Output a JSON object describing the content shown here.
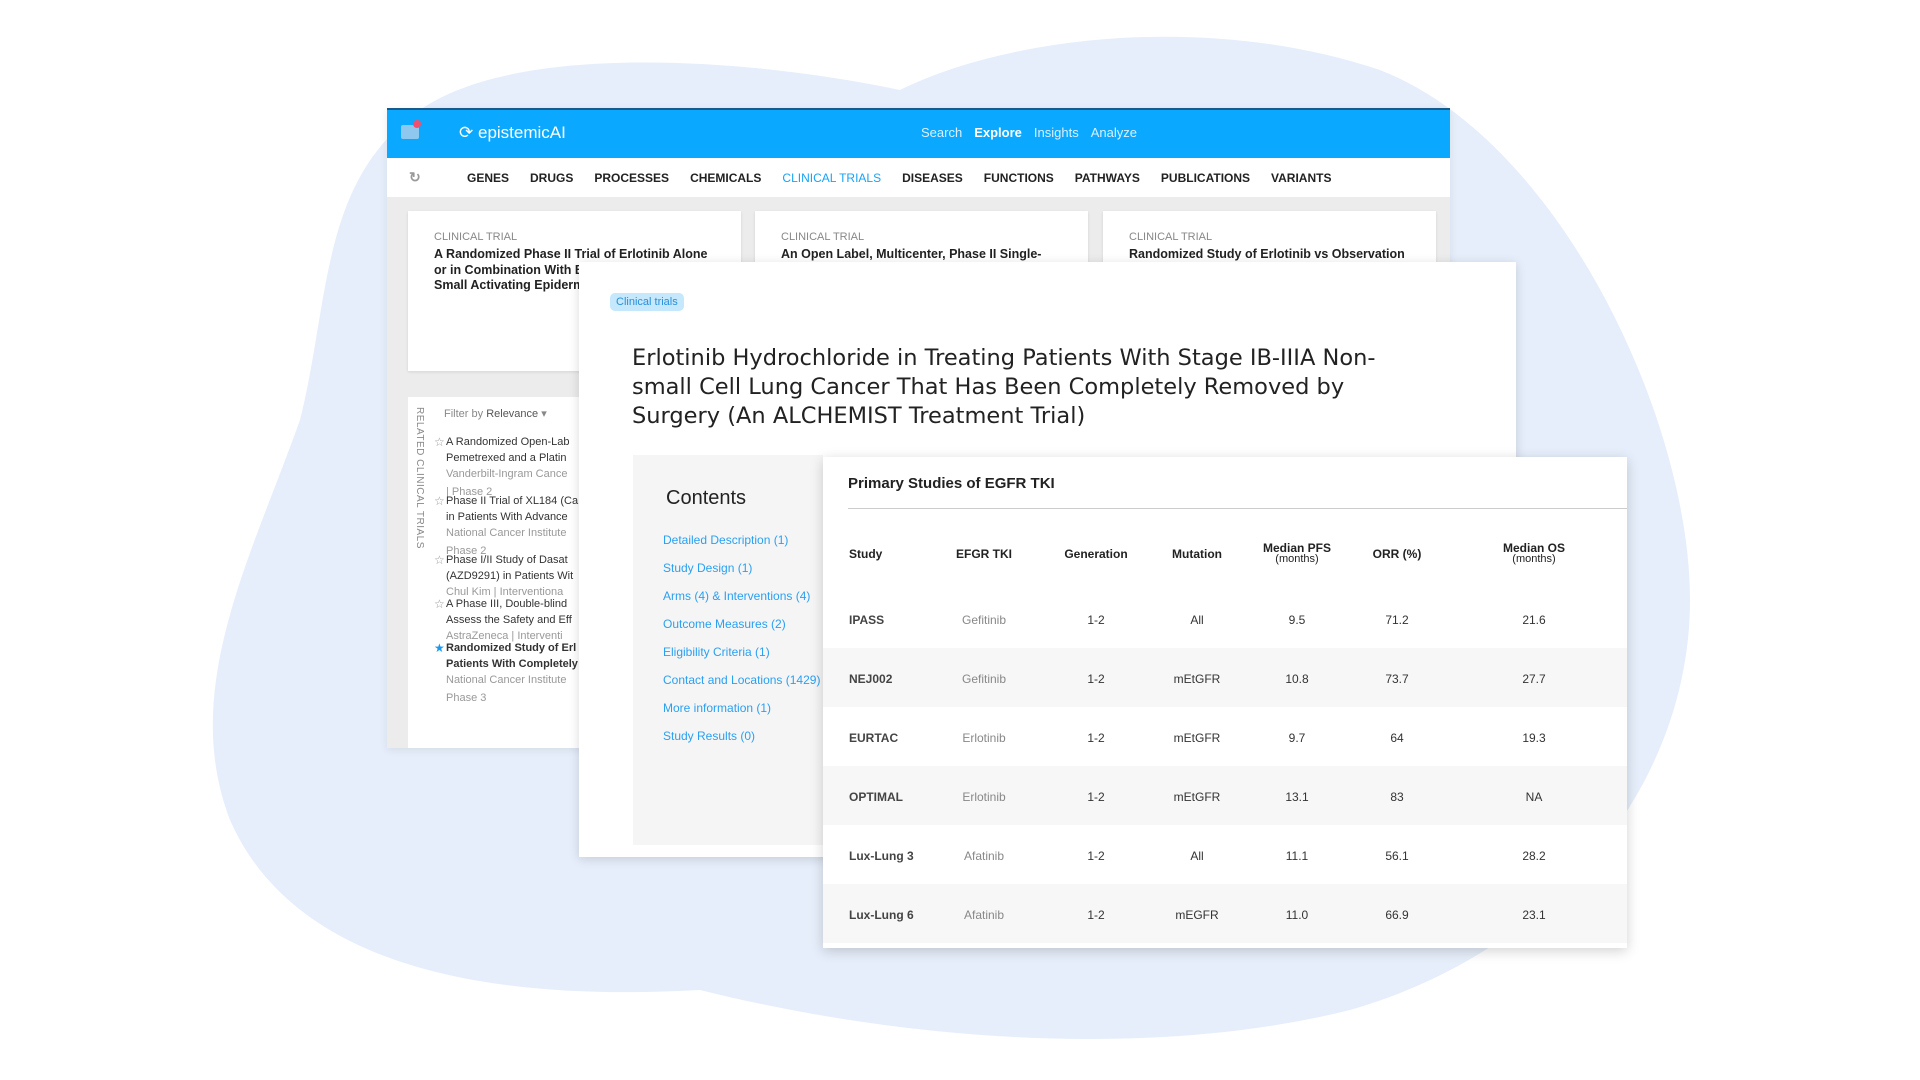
{
  "colors": {
    "header": "#0aa8ff",
    "accent": "#19a3f5",
    "blob": "#e6eefb"
  },
  "header": {
    "logo": "epistemicAI",
    "nav": [
      {
        "label": "Search"
      },
      {
        "label": "Explore",
        "active": true
      },
      {
        "label": "Insights"
      },
      {
        "label": "Analyze"
      }
    ]
  },
  "categories": [
    "GENES",
    "DRUGS",
    "PROCESSES",
    "CHEMICALS",
    "CLINICAL TRIALS",
    "DISEASES",
    "FUNCTIONS",
    "PATHWAYS",
    "PUBLICATIONS",
    "VARIANTS"
  ],
  "active_category": "CLINICAL TRIALS",
  "cards": [
    {
      "kind": "CLINICAL TRIAL",
      "title": "A Randomized Phase II Trial of Erlotinib Alone or in Combination With B Patients With Non-Small Activating Epidermal Gro Mutations"
    },
    {
      "kind": "CLINICAL TRIAL",
      "title": "An Open Label, Multicenter, Phase II Single-Arm"
    },
    {
      "kind": "CLINICAL TRIAL",
      "title": "Randomized Study of Erlotinib vs Observation"
    }
  ],
  "related": {
    "label": "RELATED CLINICAL TRIALS",
    "filter_label": "Filter by",
    "filter_value": "Relevance",
    "items": [
      {
        "l1": "A Randomized Open-Lab",
        "l2": "Pemetrexed and a Platin",
        "m1": "Vanderbilt-Ingram Cance",
        "m2": "| Phase 2",
        "starred": false
      },
      {
        "l1": "Phase II Trial of XL184 (Ca",
        "l2": "in Patients With Advance",
        "m1": "National Cancer Institute",
        "m2": "Phase 2",
        "starred": false
      },
      {
        "l1": "Phase I/II Study of Dasat",
        "l2": "(AZD9291) in Patients Wit",
        "m1": "Chul Kim  |  Interventiona",
        "m2": "",
        "starred": false
      },
      {
        "l1": "A Phase III, Double-blind",
        "l2": "Assess the Safety and Eff",
        "m1": "AstraZeneca  |  Interventi",
        "m2": "",
        "starred": false
      },
      {
        "l1": "Randomized Study of Erl",
        "l2": "Patients With Completely",
        "m1": "National Cancer Institute",
        "m2": "Phase 3",
        "starred": true
      }
    ]
  },
  "detail": {
    "badge": "Clinical trials",
    "title": "Erlotinib Hydrochloride in Treating Patients With Stage IB-IIIA Non-small Cell Lung Cancer That Has Been Completely Removed by Surgery (An ALCHEMIST Treatment Trial)",
    "contents_title": "Contents",
    "contents": [
      "Detailed Description (1)",
      "Study Design (1)",
      "Arms (4) & Interventions (4)",
      "Outcome Measures (2)",
      "Eligibility Criteria (1)",
      "Contact and Locations (1429)",
      "More information (1)",
      "Study Results (0)"
    ]
  },
  "table": {
    "title": "Primary Studies of EGFR TKI",
    "headers": [
      {
        "t": "Study"
      },
      {
        "t": "EFGR TKI"
      },
      {
        "t": "Generation"
      },
      {
        "t": "Mutation"
      },
      {
        "t": "Median PFS",
        "s": "(months)"
      },
      {
        "t": "ORR (%)"
      },
      {
        "t": "Median OS",
        "s": "(months)"
      }
    ],
    "rows": [
      [
        "IPASS",
        "Gefitinib",
        "1-2",
        "All",
        "9.5",
        "71.2",
        "21.6"
      ],
      [
        "NEJ002",
        "Gefitinib",
        "1-2",
        "mEtGFR",
        "10.8",
        "73.7",
        "27.7"
      ],
      [
        "EURTAC",
        "Erlotinib",
        "1-2",
        "mEtGFR",
        "9.7",
        "64",
        "19.3"
      ],
      [
        "OPTIMAL",
        "Erlotinib",
        "1-2",
        "mEtGFR",
        "13.1",
        "83",
        "NA"
      ],
      [
        "Lux-Lung 3",
        "Afatinib",
        "1-2",
        "All",
        "11.1",
        "56.1",
        "28.2"
      ],
      [
        "Lux-Lung 6",
        "Afatinib",
        "1-2",
        "mEGFR",
        "11.0",
        "66.9",
        "23.1"
      ]
    ]
  }
}
